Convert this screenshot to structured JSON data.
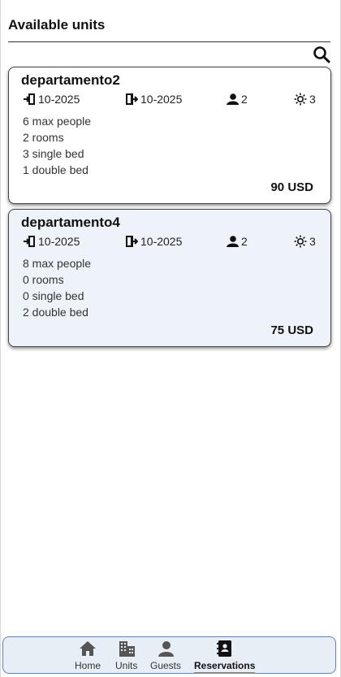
{
  "header": {
    "title": "Available units"
  },
  "search": {
    "icon": "search-icon"
  },
  "units": [
    {
      "name": "departamento2",
      "checkin": "10-2025",
      "checkout": "10-2025",
      "guests": "2",
      "nights": "3",
      "max_people": "6 max people",
      "rooms": "2 rooms",
      "single_beds": "3 single bed",
      "double_beds": "1 double bed",
      "price": "90 USD"
    },
    {
      "name": "departamento4",
      "checkin": "10-2025",
      "checkout": "10-2025",
      "guests": "2",
      "nights": "3",
      "max_people": "8 max people",
      "rooms": "0 rooms",
      "single_beds": "0 single bed",
      "double_beds": "2 double bed",
      "price": "75 USD"
    }
  ],
  "nav": {
    "home": "Home",
    "units": "Units",
    "guests": "Guests",
    "reservations": "Reservations",
    "active": "reservations"
  },
  "colors": {
    "card_alt_bg": "#eef3fa",
    "nav_bg": "#e8eef6",
    "nav_border": "#5a84b8"
  }
}
